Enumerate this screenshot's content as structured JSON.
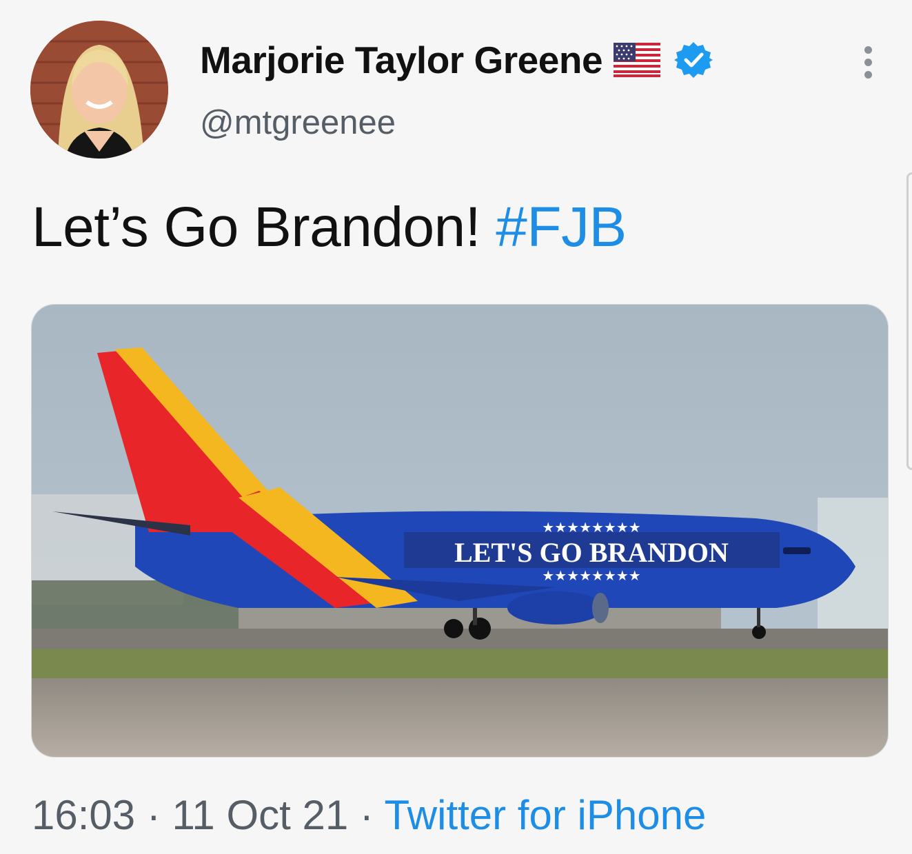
{
  "tweet": {
    "author": {
      "display_name": "Marjorie Taylor Greene",
      "handle": "@mtgreenee",
      "flag_icon": "us-flag-icon",
      "verified_icon": "verified-badge-icon"
    },
    "text": "Let’s Go Brandon! ",
    "hashtag": "#FJB",
    "media": {
      "fuselage_text": "LET'S GO BRANDON",
      "stars_top": "★★★★★★★★",
      "stars_bottom": "★★★★★★★★"
    },
    "time": "16:03",
    "separator": " · ",
    "date": "11 Oct 21",
    "source": "Twitter for iPhone"
  },
  "colors": {
    "link": "#1d8de6",
    "verified": "#1d9bf0",
    "text": "#111111",
    "muted": "#555d66"
  }
}
